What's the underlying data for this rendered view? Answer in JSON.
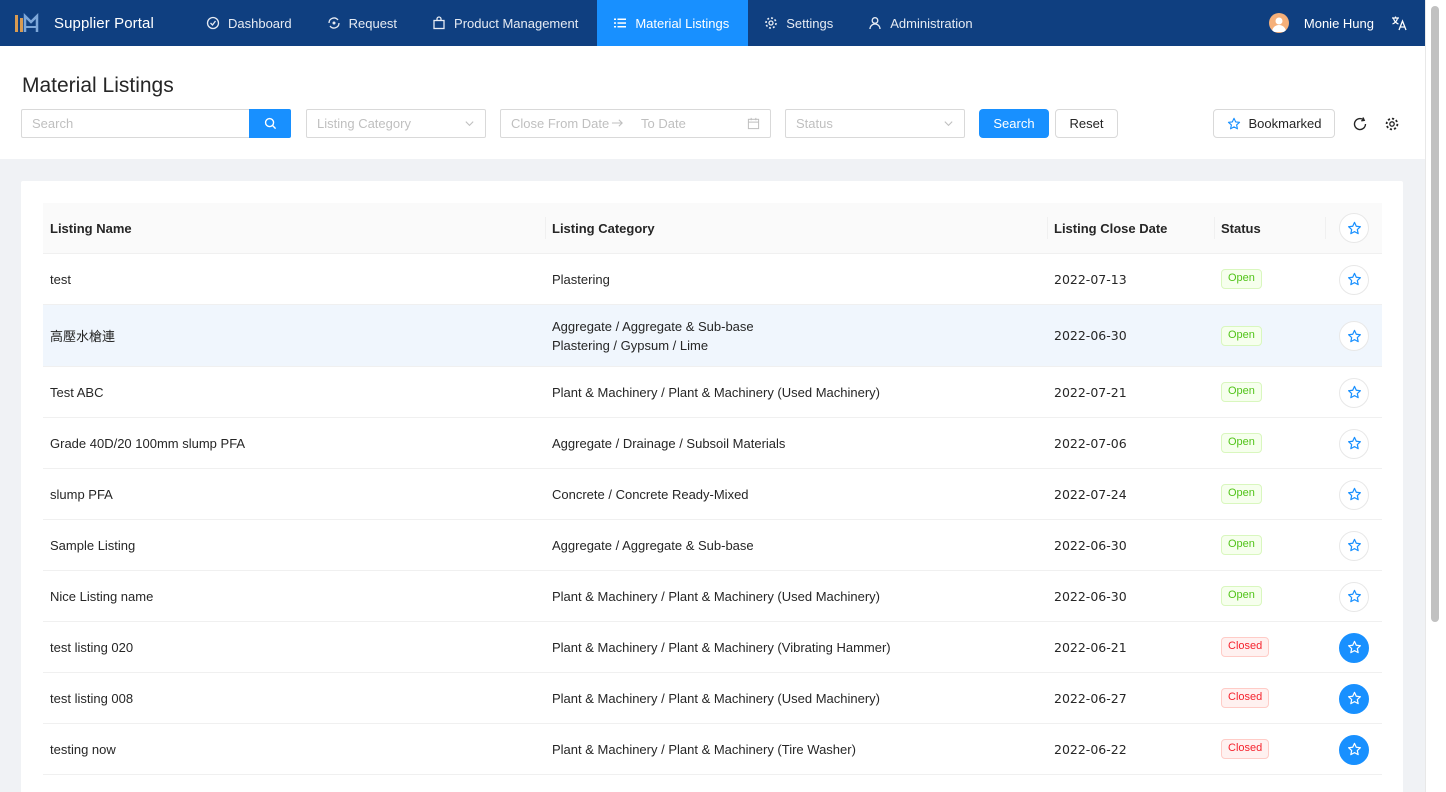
{
  "app": {
    "title": "Supplier Portal",
    "accent_color": "#1890ff",
    "nav_color": "#0f3f80"
  },
  "nav": [
    {
      "label": "Dashboard",
      "icon": "dashboard-icon"
    },
    {
      "label": "Request",
      "icon": "request-icon"
    },
    {
      "label": "Product Management",
      "icon": "shopping-bag-icon"
    },
    {
      "label": "Material Listings",
      "icon": "list-icon",
      "active": true
    },
    {
      "label": "Settings",
      "icon": "gear-icon"
    },
    {
      "label": "Administration",
      "icon": "user-icon"
    }
  ],
  "user": {
    "name": "Monie Hung"
  },
  "page": {
    "title": "Material Listings"
  },
  "filters": {
    "search_placeholder": "Search",
    "category_placeholder": "Listing Category",
    "from_date_placeholder": "Close From Date",
    "to_date_placeholder": "To Date",
    "status_placeholder": "Status",
    "search_label": "Search",
    "reset_label": "Reset",
    "bookmarked_label": "Bookmarked"
  },
  "table": {
    "columns": [
      "Listing Name",
      "Listing Category",
      "Listing Close Date",
      "Status"
    ],
    "rows": [
      {
        "name": "test",
        "category": [
          "Plastering"
        ],
        "close_date": "2022-07-13",
        "status": "Open",
        "bookmarked": false
      },
      {
        "name": "高壓水槍連",
        "category": [
          "Aggregate / Aggregate & Sub-base",
          "Plastering / Gypsum / Lime"
        ],
        "close_date": "2022-06-30",
        "status": "Open",
        "bookmarked": false
      },
      {
        "name": "Test ABC",
        "category": [
          "Plant & Machinery / Plant & Machinery (Used Machinery)"
        ],
        "close_date": "2022-07-21",
        "status": "Open",
        "bookmarked": false
      },
      {
        "name": "Grade 40D/20 100mm slump PFA",
        "category": [
          "Aggregate / Drainage / Subsoil Materials"
        ],
        "close_date": "2022-07-06",
        "status": "Open",
        "bookmarked": false
      },
      {
        "name": "slump PFA",
        "category": [
          "Concrete / Concrete Ready-Mixed"
        ],
        "close_date": "2022-07-24",
        "status": "Open",
        "bookmarked": false
      },
      {
        "name": "Sample Listing",
        "category": [
          "Aggregate / Aggregate & Sub-base"
        ],
        "close_date": "2022-06-30",
        "status": "Open",
        "bookmarked": false
      },
      {
        "name": "Nice Listing name",
        "category": [
          "Plant & Machinery / Plant & Machinery (Used Machinery)"
        ],
        "close_date": "2022-06-30",
        "status": "Open",
        "bookmarked": false
      },
      {
        "name": "test listing 020",
        "category": [
          "Plant & Machinery / Plant & Machinery (Vibrating Hammer)"
        ],
        "close_date": "2022-06-21",
        "status": "Closed",
        "bookmarked": true
      },
      {
        "name": "test listing 008",
        "category": [
          "Plant & Machinery / Plant & Machinery (Used Machinery)"
        ],
        "close_date": "2022-06-27",
        "status": "Closed",
        "bookmarked": true
      },
      {
        "name": "testing now",
        "category": [
          "Plant & Machinery / Plant & Machinery (Tire Washer)"
        ],
        "close_date": "2022-06-22",
        "status": "Closed",
        "bookmarked": true
      }
    ]
  }
}
